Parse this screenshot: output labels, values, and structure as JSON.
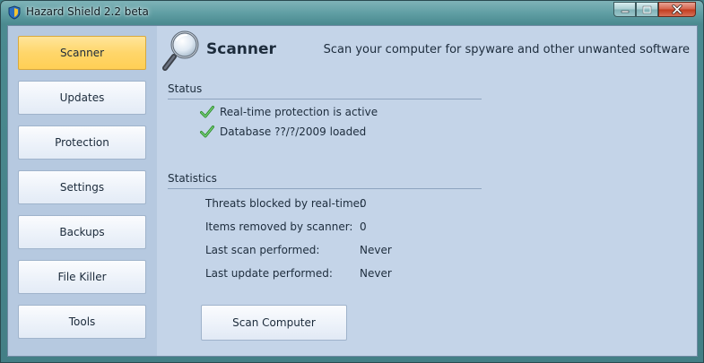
{
  "window": {
    "title": "Hazard Shield 2.2 beta"
  },
  "sidebar": {
    "items": [
      {
        "label": "Scanner"
      },
      {
        "label": "Updates"
      },
      {
        "label": "Protection"
      },
      {
        "label": "Settings"
      },
      {
        "label": "Backups"
      },
      {
        "label": "File Killer"
      },
      {
        "label": "Tools"
      }
    ],
    "active_index": 0
  },
  "header": {
    "title": "Scanner",
    "subtitle": "Scan your computer for spyware and other unwanted software"
  },
  "status": {
    "label": "Status",
    "items": [
      {
        "text": "Real-time protection is active",
        "icon": "green-check-icon"
      },
      {
        "text": "Database ??/?/2009 loaded",
        "icon": "green-check-icon"
      }
    ]
  },
  "statistics": {
    "label": "Statistics",
    "rows": [
      {
        "label": "Threats blocked by real-time:",
        "value": "0"
      },
      {
        "label": "Items removed by scanner:",
        "value": "0"
      },
      {
        "label": "Last scan performed:",
        "value": "Never"
      },
      {
        "label": "Last update performed:",
        "value": "Never"
      }
    ]
  },
  "actions": {
    "scan_label": "Scan Computer"
  },
  "colors": {
    "accent_active": "#ffd66a",
    "panel_bg": "#c4d4e8",
    "sidebar_bg": "#b6c9e0",
    "check_green": "#3aa83a"
  }
}
